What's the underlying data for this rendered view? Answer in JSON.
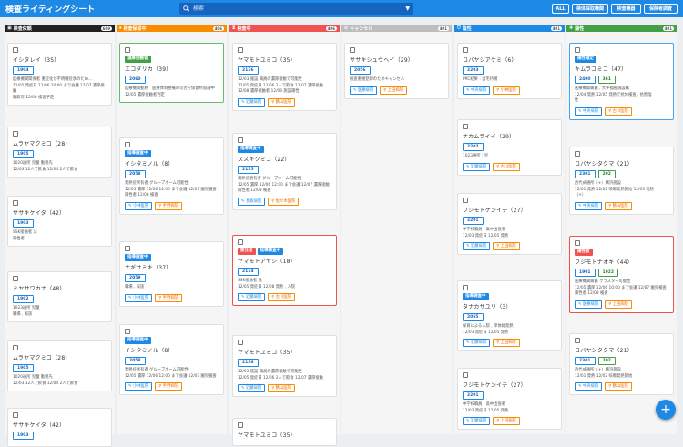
{
  "app": {
    "title": "検査ライティングシート",
    "search_placeholder": "検索",
    "top_buttons": [
      "ALL",
      "検体採取機関",
      "検査機器",
      "保険者調査"
    ]
  },
  "colors": {
    "topbar": "#1e88e5",
    "col_black": "#212121",
    "col_orange": "#fb8c00",
    "col_red": "#ef5350",
    "col_grey": "#bdbdbd",
    "col_blue": "#1e88e5",
    "col_green": "#43a047"
  },
  "columns": [
    {
      "title": "検査依頼",
      "count": "699",
      "icon": "tray-icon"
    },
    {
      "title": "検査保留中",
      "count": "406",
      "icon": "pause-icon"
    },
    {
      "title": "検査中",
      "count": "406",
      "icon": "hourglass-icon"
    },
    {
      "title": "キャンセル",
      "count": "401",
      "icon": "cancel-icon"
    },
    {
      "title": "陰性",
      "count": "401",
      "icon": "shield-icon"
    },
    {
      "title": "陽性",
      "count": "401",
      "icon": "plus-shield-icon"
    }
  ],
  "cards": {
    "c0": [
      {
        "name": "イシタレイ（35）",
        "ids": [
          "1904"
        ],
        "text": [
          "医療機関関係者 重症化が不明確症状のため…",
          "12/05 発症日 12/06 10:00 まで会議 12/07 濃厚接触",
          "聴取有 12/08 検査予定"
        ]
      },
      {
        "name": "ムラヤマクミコ（28）",
        "ids": [
          "1905"
        ],
        "text": [
          "1020通所 児童 勤務先",
          "12/03 12人で飲食 12/04 2人で飲食"
        ]
      },
      {
        "name": "ササキケイタ（42）",
        "ids": [
          "1903"
        ],
        "text": [
          "SSK接触者 父",
          "陽性者"
        ]
      },
      {
        "name": "ミヤサワカナ（48）",
        "ids": [
          "1902"
        ],
        "text": [
          "1023通所 児童",
          "職場 , 家族"
        ]
      },
      {
        "name": "ムラヤマクミコ（28）",
        "ids": [
          "1905"
        ],
        "text": [
          "1020通所 児童 勤務先",
          "12/03 12人で飲食 12/04 2人で飲食"
        ]
      },
      {
        "name": "ササキケイタ（42）",
        "ids": [
          "1903"
        ],
        "text": []
      }
    ],
    "c1": [
      {
        "tags": [
          "濃厚接触者"
        ],
        "name": "エコダリカ（39）",
        "ids": [
          "2060"
        ],
        "text": [
          "医療機関勤務　医療体制整備の可否を保健所協議中",
          "12/05 濃厚接触者判定"
        ],
        "selected": "green"
      },
      {
        "tags": [
          "指導調査中"
        ],
        "name": "イシタミノル（8）",
        "ids": [
          "2058"
        ],
        "text": [
          "発熱症状有者 グループホーム可能性",
          "12/05 濃厚 12/06 12:00 まで会議 12/07 園児検査",
          "陽性者 12/08 検査"
        ],
        "buttons": [
          "小林医院",
          "手野病院"
        ]
      },
      {
        "tags": [
          "指導調査中"
        ],
        "name": "ナギサミキ（37）",
        "ids": [
          "2059"
        ],
        "text": [
          "職場 , 家族"
        ],
        "buttons": [
          "小林医院",
          "手野病院"
        ]
      },
      {
        "tags": [
          "指導調査中"
        ],
        "name": "イシタミノル（8）",
        "ids": [
          "2058"
        ],
        "text": [
          "発熱症状有者 グループホーム可能性",
          "12/05 濃厚 12/06 12:00 まで会議 12/07 園児検査"
        ],
        "buttons": [
          "小林医院",
          "手野病院"
        ]
      }
    ],
    "c2": [
      {
        "name": "ヤマモトユミコ（35）",
        "ids": [
          "2136"
        ],
        "text": [
          "12/03 施設 職員の濃厚接触で可能性",
          "12/05 発症日 12/06 2人で飲食 12/07 濃厚接触",
          "12/08 濃厚接触者 12/09 施設陽性"
        ],
        "buttons": [
          "近藤病院",
          "鶴山医院"
        ]
      },
      {
        "tags": [
          "指導調査中"
        ],
        "name": "ススキクミコ（22）",
        "ids": [
          "2135"
        ],
        "text": [
          "発熱症状有者 グループホーム可能性",
          "12/05 濃厚 12/06 12:00 まで会議 12/07 濃厚接触",
          "陽性者 12/08 検査"
        ],
        "buttons": [
          "長坂病院",
          "佐々木医院"
        ]
      },
      {
        "tags": [
          "要注意",
          "指導調査中"
        ],
        "name": "ヤマモトアヤシ（18）",
        "ids": [
          "2134"
        ],
        "text": [
          "SSK接触者 兄",
          "12/05 発症日 12/08 発熱 , 入院"
        ],
        "buttons": [
          "近藤病院",
          "古川医院"
        ],
        "selected": "red"
      },
      {
        "name": "ヤマモトユミコ（35）",
        "ids": [
          "2136"
        ],
        "text": [
          "12/03 施設 職員の濃厚接触で可能性",
          "12/05 発症日 12/06 2人で飲食 12/07 濃厚接触"
        ],
        "buttons": [
          "近藤病院",
          "鶴山医院"
        ]
      },
      {
        "name": "ヤマモトユミコ（35）",
        "ids": [],
        "text": []
      }
    ],
    "c3": [
      {
        "name": "ササキシュウヘイ（29）",
        "ids": [
          "2056"
        ],
        "text": [
          "検査重複登録のためキャンセル"
        ],
        "buttons": [
          "医療病院",
          "上田病院"
        ]
      }
    ],
    "c4": [
      {
        "name": "コバヤシアケミ（6）",
        "ids": [
          "2203"
        ],
        "text": [
          "PRC結果 : 自宅待機"
        ],
        "buttons": [
          "中央病院",
          "小林医院"
        ]
      },
      {
        "name": "ナカムライイ（29）",
        "ids": [
          "2202"
        ],
        "text": [
          "1023通所 : 児"
        ],
        "buttons": [
          "近藤病院",
          "古川医院"
        ]
      },
      {
        "name": "フジモトケンイチ（27）",
        "ids": [
          "2201"
        ],
        "text": [
          "中学校職員 , 高中出張者",
          "12/03 発症日 12/05 発熱"
        ],
        "buttons": [
          "近藤病院",
          "上田病院"
        ]
      },
      {
        "tags": [
          "指導調査中"
        ],
        "name": "タナカサユリ（3）",
        "ids": [
          "2055"
        ],
        "text": [
          "保育による入院 , 単体総発熱",
          "12/03 発症日 12/05 発熱"
        ],
        "buttons": [
          "近藤病院",
          "上田病院"
        ]
      },
      {
        "name": "フジモトケンイチ（27）",
        "ids": [
          "2201"
        ],
        "text": [
          "中学校職員 , 高中出張者",
          "12/03 発症日 12/05 発熱"
        ],
        "buttons": [
          "近藤病院",
          "上田病院"
        ]
      }
    ],
    "c5": [
      {
        "tags": [
          "陽性確定"
        ],
        "name": "キムラユミコ（47）",
        "ids": [
          "2400",
          "361"
        ],
        "text": [
          "医療機関職員 , 大手福祉施設職",
          "12/04 発熱 12/05 発熱で抗体検査 , 抗原陰",
          "性"
        ],
        "buttons": [
          "中央病院",
          "古川医院"
        ],
        "selected": "blue"
      },
      {
        "name": "コバヤシタクマ（21）",
        "ids": [
          "2301",
          "202"
        ],
        "text": [
          "西代式通所（+）横浜施設",
          "12/01 発熱 12/02 咳嗽発熱開始 12/03 発熱",
          "（+）"
        ],
        "buttons": [
          "中央病院",
          "鶴山医院"
        ]
      },
      {
        "tags": [
          "陽性者"
        ],
        "name": "フジモトナオキ（44）",
        "ids": [
          "1901",
          "1022"
        ],
        "text": [
          "医療機関職員 クラスター可能性",
          "12/05 濃厚 12/06 10:00 まで会議 12/07 園児検査",
          "陽性者 12/08 検査"
        ],
        "buttons": [
          "医療病院",
          "上田病院"
        ],
        "selected": "red"
      },
      {
        "name": "コバヤシタクマ（21）",
        "ids": [
          "2301",
          "202"
        ],
        "text": [
          "西代式通所（+）横浜施設",
          "12/01 発熱 12/02 咳嗽発熱開始"
        ],
        "buttons": [
          "中央病院",
          "鶴山医院"
        ]
      }
    ]
  }
}
